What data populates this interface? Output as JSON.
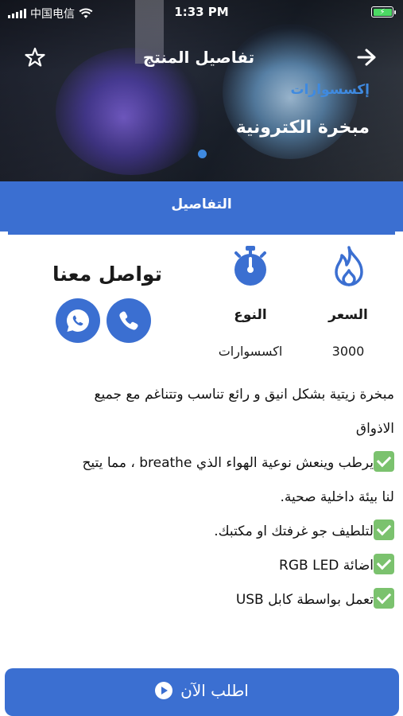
{
  "status_bar": {
    "carrier": "中国电信",
    "time": "1:33 PM"
  },
  "nav": {
    "title": "تفاصيل المنتج",
    "back_icon": "arrow-left-icon",
    "favorite_icon": "star-outline-icon"
  },
  "hero": {
    "category": "إكسسوارات",
    "product_name": "مبخرة الكترونية"
  },
  "tabs": [
    {
      "label": "التفاصيل",
      "active": true
    }
  ],
  "info": {
    "price_label": "السعر",
    "price_value": "3000",
    "price_icon": "flame-icon",
    "type_label": "النوع",
    "type_value": "اكسسوارات",
    "type_icon": "stopwatch-icon"
  },
  "contact": {
    "title": "تواصل معنا",
    "call_icon": "phone-icon",
    "whatsapp_icon": "whatsapp-icon"
  },
  "description": {
    "lines": [
      "مبخرة زيتية بشكل انيق و رائع تناسب وتتناغم مع جميع",
      "الاذواق",
      "يرطب وينعش نوعية الهواء الذي breathe ، مما يتيح",
      "لنا بيئة داخلية صحية.",
      "لتلطيف جو غرفتك او مكتبك.",
      "اضائة RGB LED",
      "تعمل بواسطة كابل USB"
    ]
  },
  "order_button": {
    "label": "اطلب الآن"
  },
  "colors": {
    "accent": "#3b6fd1",
    "category": "#3f8ae0",
    "check": "#7bc26e"
  }
}
